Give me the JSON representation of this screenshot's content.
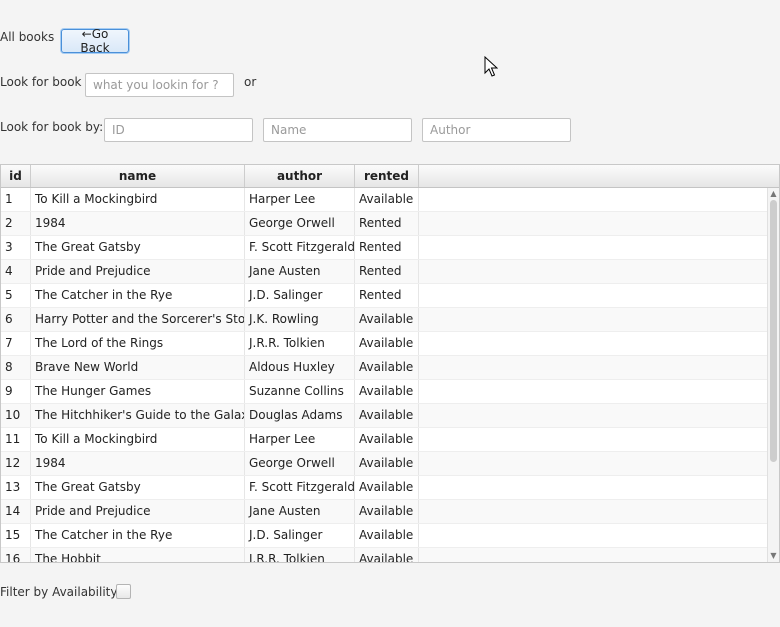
{
  "header": {
    "all_books_label": "All books",
    "go_back_label": "←Go Back"
  },
  "search": {
    "look_for_label": "Look for book",
    "general_placeholder": "what you lookin for ?",
    "or_label": "or",
    "look_by_label": "Look for book by:",
    "id_placeholder": "ID",
    "name_placeholder": "Name",
    "author_placeholder": "Author"
  },
  "table": {
    "columns": [
      "id",
      "name",
      "author",
      "rented"
    ],
    "rows": [
      {
        "id": "1",
        "name": "To Kill a Mockingbird",
        "author": "Harper Lee",
        "rented": "Available"
      },
      {
        "id": "2",
        "name": "1984",
        "author": "George Orwell",
        "rented": "Rented"
      },
      {
        "id": "3",
        "name": "The Great Gatsby",
        "author": "F. Scott Fitzgerald",
        "rented": "Rented"
      },
      {
        "id": "4",
        "name": "Pride and Prejudice",
        "author": "Jane Austen",
        "rented": "Rented"
      },
      {
        "id": "5",
        "name": "The Catcher in the Rye",
        "author": "J.D. Salinger",
        "rented": "Rented"
      },
      {
        "id": "6",
        "name": "Harry Potter and the Sorcerer's Stone",
        "author": "J.K. Rowling",
        "rented": "Available"
      },
      {
        "id": "7",
        "name": "The Lord of the Rings",
        "author": "J.R.R. Tolkien",
        "rented": "Available"
      },
      {
        "id": "8",
        "name": "Brave New World",
        "author": "Aldous Huxley",
        "rented": "Available"
      },
      {
        "id": "9",
        "name": "The Hunger Games",
        "author": "Suzanne Collins",
        "rented": "Available"
      },
      {
        "id": "10",
        "name": "The Hitchhiker's Guide to the Galaxy",
        "author": "Douglas Adams",
        "rented": "Available"
      },
      {
        "id": "11",
        "name": "To Kill a Mockingbird",
        "author": "Harper Lee",
        "rented": "Available"
      },
      {
        "id": "12",
        "name": "1984",
        "author": "George Orwell",
        "rented": "Available"
      },
      {
        "id": "13",
        "name": "The Great Gatsby",
        "author": "F. Scott Fitzgerald",
        "rented": "Available"
      },
      {
        "id": "14",
        "name": "Pride and Prejudice",
        "author": "Jane Austen",
        "rented": "Available"
      },
      {
        "id": "15",
        "name": "The Catcher in the Rye",
        "author": "J.D. Salinger",
        "rented": "Available"
      },
      {
        "id": "16",
        "name": "The Hobbit",
        "author": "J.R.R. Tolkien",
        "rented": "Available"
      }
    ]
  },
  "filter": {
    "availability_label": "Filter by Availability:",
    "checked": false
  }
}
